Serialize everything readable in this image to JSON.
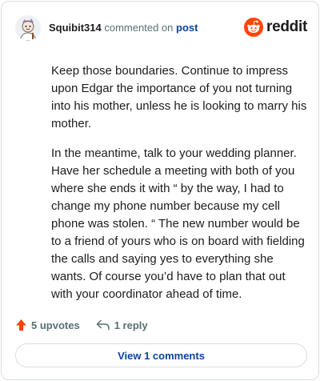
{
  "header": {
    "username": "Squibit314",
    "action_text": "commented on",
    "post_link": "post",
    "logo_text": "reddit",
    "brand_color": "#ff4500"
  },
  "comment": {
    "paragraphs": [
      "Keep those boundaries. Continue to impress upon Edgar the importance of you not turning into his mother, unless he is looking to marry his mother.",
      "In the meantime, talk to your wedding planner. Have her schedule a meeting with both of you where she ends it with “ by the way, I had to change my phone number because my cell phone was stolen. “ The new number would be to a friend of yours who is on board with fielding the calls and saying yes to everything she wants. Of course you’d have to plan that out with your coordinator ahead of time."
    ]
  },
  "actions": {
    "upvotes": "5 upvotes",
    "reply": "1 reply"
  },
  "view_comments_label": "View 1 comments",
  "icons": {
    "avatar": "avatar-icon",
    "logo": "reddit-logo-icon",
    "upvote": "upvote-arrow-icon",
    "reply": "reply-arrow-icon"
  }
}
